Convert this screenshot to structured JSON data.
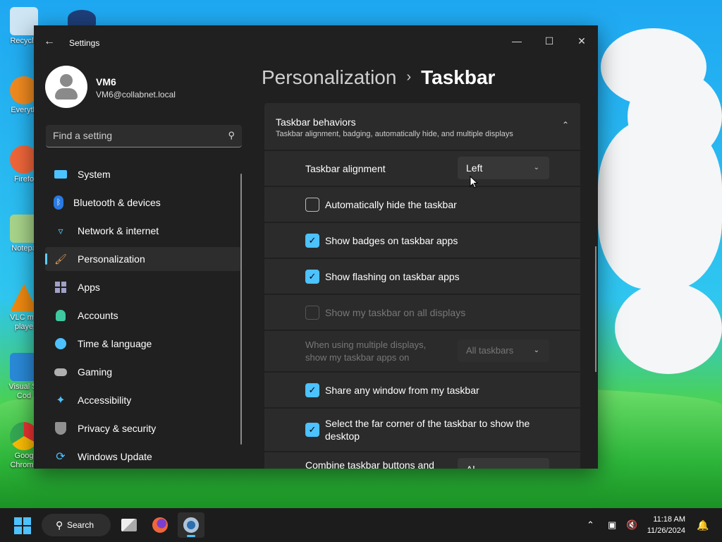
{
  "desktop": {
    "icons": [
      {
        "label": "Recycle",
        "icon": "recycle-bin-icon"
      },
      {
        "label": "Everyth",
        "icon": "everything-search-icon"
      },
      {
        "label": "Firefo",
        "icon": "firefox-icon"
      },
      {
        "label": "Notepa",
        "icon": "notepad-icon"
      },
      {
        "label": "VLC me playe",
        "icon": "vlc-icon"
      },
      {
        "label": "Visual St Cod",
        "icon": "vscode-icon"
      },
      {
        "label": "Goog Chrome",
        "icon": "chrome-icon"
      }
    ]
  },
  "window": {
    "title": "Settings",
    "back_icon": "←",
    "minimize": "—",
    "maximize": "☐",
    "close": "✕"
  },
  "user": {
    "name": "VM6",
    "email": "VM6@collabnet.local"
  },
  "search": {
    "placeholder": "Find a setting",
    "value": ""
  },
  "nav": [
    {
      "label": "System",
      "icon": "system-icon",
      "color": "#4cc2ff"
    },
    {
      "label": "Bluetooth & devices",
      "icon": "bluetooth-icon",
      "color": "#3a9ff5"
    },
    {
      "label": "Network & internet",
      "icon": "wifi-icon",
      "color": "#5bc8f5"
    },
    {
      "label": "Personalization",
      "icon": "brush-icon",
      "color": "#e0a060",
      "active": true
    },
    {
      "label": "Apps",
      "icon": "apps-icon",
      "color": "#a0a0c8"
    },
    {
      "label": "Accounts",
      "icon": "accounts-icon",
      "color": "#3ec9a0"
    },
    {
      "label": "Time & language",
      "icon": "globe-icon",
      "color": "#4cc2ff"
    },
    {
      "label": "Gaming",
      "icon": "gamepad-icon",
      "color": "#b0b0b0"
    },
    {
      "label": "Accessibility",
      "icon": "accessibility-icon",
      "color": "#4cc2ff"
    },
    {
      "label": "Privacy & security",
      "icon": "shield-icon",
      "color": "#909090"
    },
    {
      "label": "Windows Update",
      "icon": "update-icon",
      "color": "#4cc2ff"
    }
  ],
  "breadcrumb": {
    "parent": "Personalization",
    "separator": "›",
    "current": "Taskbar"
  },
  "section": {
    "title": "Taskbar behaviors",
    "subtitle": "Taskbar alignment, badging, automatically hide, and multiple displays",
    "chevron": "⌃"
  },
  "settings": {
    "alignment": {
      "label": "Taskbar alignment",
      "value": "Left"
    },
    "auto_hide": {
      "label": "Automatically hide the taskbar",
      "checked": false
    },
    "badges": {
      "label": "Show badges on taskbar apps",
      "checked": true
    },
    "flashing": {
      "label": "Show flashing on taskbar apps",
      "checked": true
    },
    "all_displays": {
      "label": "Show my taskbar on all displays",
      "checked": false,
      "disabled": true
    },
    "multi_display": {
      "label_line1": "When using multiple displays,",
      "label_line2": "show my taskbar apps on",
      "value": "All taskbars",
      "disabled": true
    },
    "share_window": {
      "label": "Share any window from my taskbar",
      "checked": true
    },
    "far_corner": {
      "label_line1": "Select the far corner of the taskbar to show the",
      "label_line2": "desktop",
      "checked": true
    },
    "combine": {
      "label": "Combine taskbar buttons and",
      "value": "Al"
    }
  },
  "taskbar": {
    "search_label": "Search",
    "time": "11:18 AM",
    "date": "11/26/2024",
    "accent": "#4cc2ff"
  }
}
